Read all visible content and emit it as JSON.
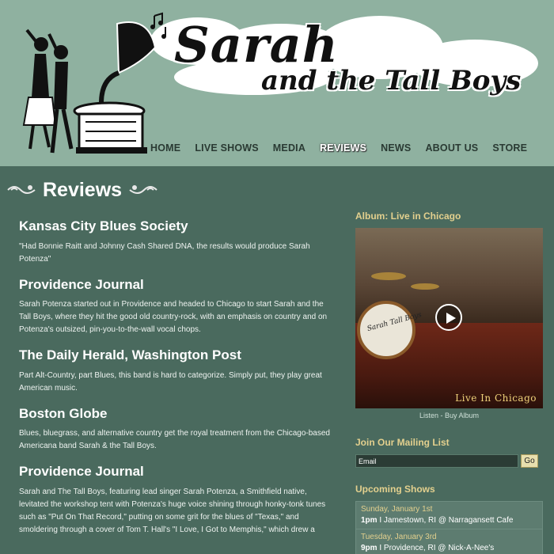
{
  "site": {
    "logo_line1": "Sarah",
    "logo_line2": "and the Tall Boys"
  },
  "nav": {
    "items": [
      {
        "label": "HOME"
      },
      {
        "label": "LIVE SHOWS"
      },
      {
        "label": "MEDIA"
      },
      {
        "label": "REVIEWS"
      },
      {
        "label": "NEWS"
      },
      {
        "label": "ABOUT US"
      },
      {
        "label": "STORE"
      }
    ],
    "active": "REVIEWS"
  },
  "page": {
    "title": "Reviews"
  },
  "reviews": [
    {
      "source": "Kansas City Blues Society",
      "text": "\"Had Bonnie Raitt and Johnny Cash Shared DNA, the results would produce Sarah Potenza\""
    },
    {
      "source": "Providence Journal",
      "text": "Sarah Potenza started out in Providence and headed to Chicago to start Sarah and the Tall Boys, where they hit the good old country-rock, with an emphasis on country and on Potenza's outsized, pin-you-to-the-wall vocal chops."
    },
    {
      "source": "The Daily Herald, Washington Post",
      "text": "Part Alt-Country, part Blues, this band is hard to categorize. Simply put, they play great American music."
    },
    {
      "source": "Boston Globe",
      "text": "Blues, bluegrass, and alternative country get the royal treatment from the Chicago-based Americana band Sarah & the Tall Boys."
    },
    {
      "source": "Providence Journal",
      "text": "Sarah and The Tall Boys, featuring lead singer Sarah Potenza, a Smithfield native, levitated the workshop tent with Potenza's huge voice shining through honky-tonk tunes such as \"Put On That Record,\" putting on some grit for the blues of \"Texas,\" and smoldering through a cover of Tom T. Hall's \"I Love, I Got to Memphis,\" which drew a"
    }
  ],
  "sidebar": {
    "album_heading": "Album: Live in Chicago",
    "album_cover_text": "Live In Chicago",
    "drum_text": "Sarah Tall Boys",
    "listen_label": "Listen",
    "separator": " - ",
    "buy_label": "Buy Album",
    "mailing_heading": "Join Our Mailing List",
    "email_value": "Email",
    "go_label": "Go",
    "shows_heading": "Upcoming Shows",
    "shows": [
      {
        "date": "Sunday, January 1st",
        "time": "1pm",
        "sep": " I ",
        "venue": "Jamestown, RI @ Narragansett Cafe"
      },
      {
        "date": "Tuesday, January 3rd",
        "time": "9pm",
        "sep": " I ",
        "venue": "Providence, RI @ Nick-A-Nee's"
      }
    ]
  },
  "colors": {
    "background": "#4a6a5e",
    "header": "#8fb1a0",
    "accent_gold": "#e3d08e"
  }
}
